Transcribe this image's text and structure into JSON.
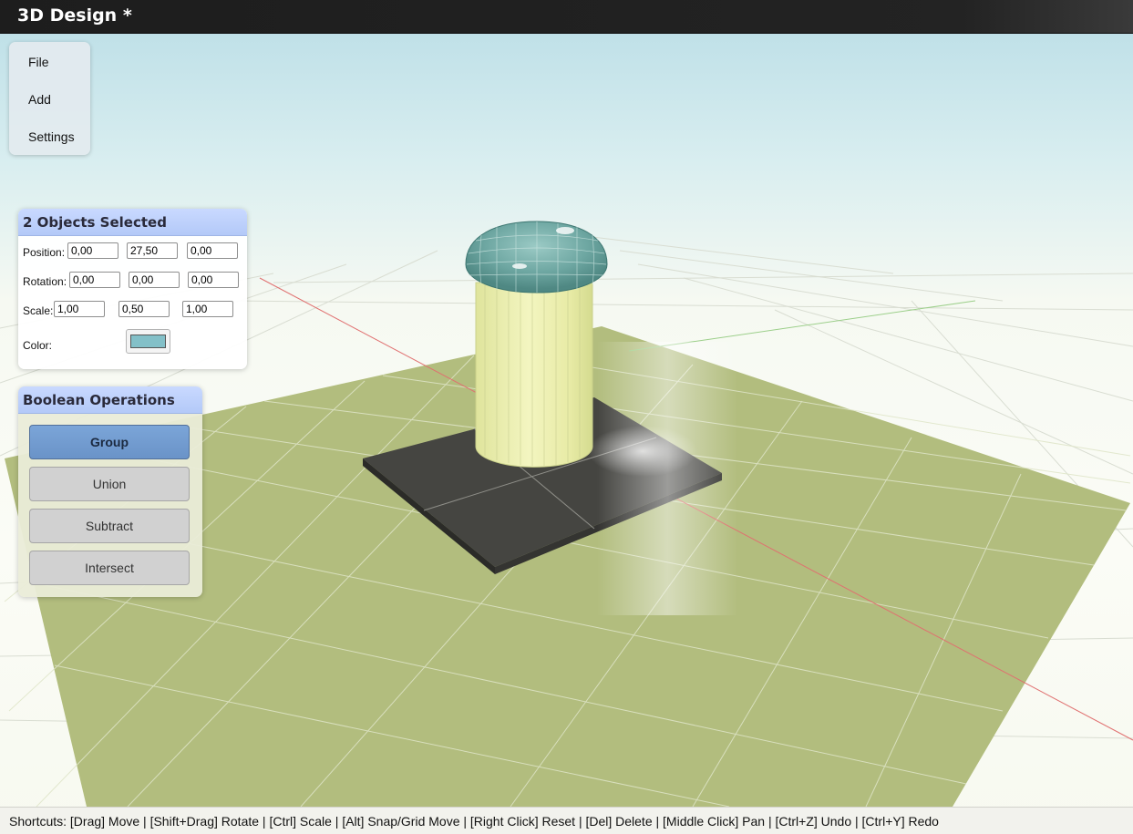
{
  "app": {
    "title": "3D Design *"
  },
  "menu": {
    "items": [
      "File",
      "Add",
      "Settings"
    ]
  },
  "properties": {
    "header": "2 Objects Selected",
    "position": {
      "label": "Position:",
      "x": "0,00",
      "y": "27,50",
      "z": "0,00"
    },
    "rotation": {
      "label": "Rotation:",
      "x": "0,00",
      "y": "0,00",
      "z": "0,00"
    },
    "scale": {
      "label": "Scale:",
      "x": "1,00",
      "y": "0,50",
      "z": "1,00"
    },
    "color": {
      "label": "Color:",
      "value": "#83c0c8"
    }
  },
  "boolean": {
    "header": "Boolean Operations",
    "buttons": [
      "Group",
      "Union",
      "Subtract",
      "Intersect"
    ],
    "active": "Group"
  },
  "scene": {
    "ground_color": "#b2bd7e",
    "base_plate_color": "#454541",
    "cylinder_color": "#ecefad",
    "dome_color": "#6ea7a2",
    "x_axis_color": "#e07070",
    "z_axis_color": "#9ccf8a"
  },
  "status": {
    "shortcuts": "Shortcuts: [Drag] Move | [Shift+Drag] Rotate | [Ctrl] Scale | [Alt] Snap/Grid Move | [Right Click] Reset | [Del] Delete | [Middle Click] Pan | [Ctrl+Z] Undo | [Ctrl+Y] Redo"
  }
}
